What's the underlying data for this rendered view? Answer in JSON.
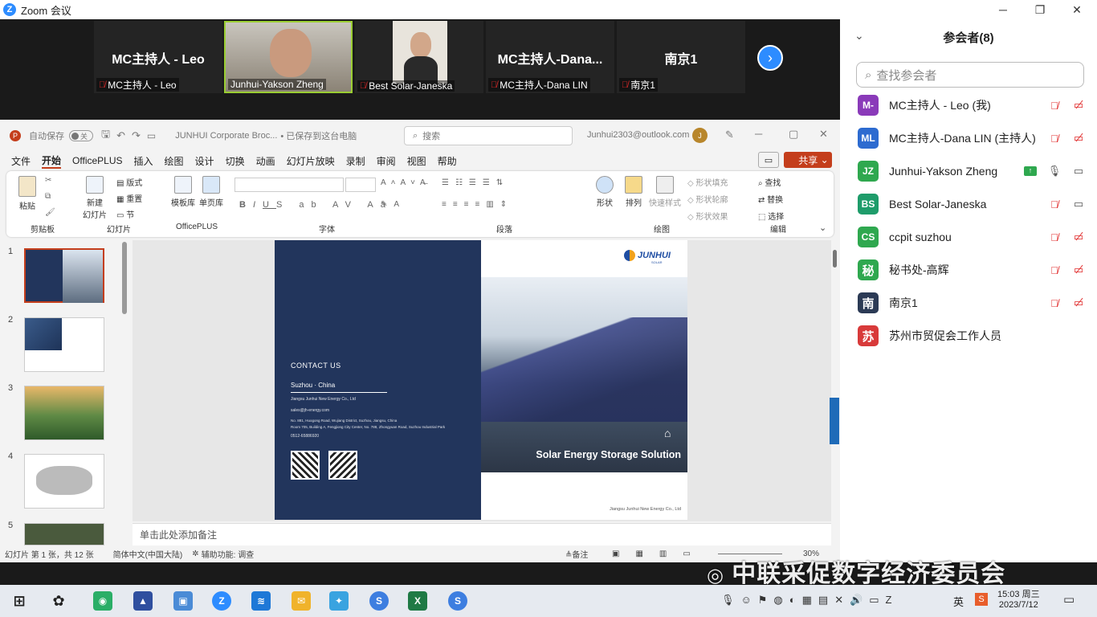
{
  "window": {
    "title": "Zoom 会议"
  },
  "colors": {
    "zoom_blue": "#2d8cff",
    "ppt_orange": "#c43e1c",
    "slide_navy": "#22355c"
  },
  "videos": [
    {
      "big": "MC主持人 - Leo",
      "label": "MC主持人 - Leo"
    },
    {
      "big": "",
      "label": "Junhui-Yakson Zheng"
    },
    {
      "big": "",
      "label": "Best Solar-Janeska"
    },
    {
      "big": "MC主持人-Dana...",
      "label": "MC主持人-Dana LIN"
    },
    {
      "big": "南京1",
      "label": "南京1"
    }
  ],
  "participants": {
    "title": "参会者(8)",
    "search_placeholder": "查找参会者",
    "list": [
      {
        "initials": "M-",
        "name": "MC主持人 - Leo (我)",
        "color": "#8a3ab9"
      },
      {
        "initials": "ML",
        "name": "MC主持人-Dana LIN (主持人)",
        "color": "#2d6bd0"
      },
      {
        "initials": "JZ",
        "name": "Junhui-Yakson Zheng",
        "color": "#2fa84f"
      },
      {
        "initials": "BS",
        "name": "Best Solar-Janeska",
        "color": "#1e9c6a"
      },
      {
        "initials": "CS",
        "name": "ccpit suzhou",
        "color": "#2fa84f"
      },
      {
        "initials": "秘",
        "name": "秘书处-高辉",
        "color": "#2fa84f"
      },
      {
        "initials": "南",
        "name": "南京1",
        "color": "#2b3a55"
      },
      {
        "initials": "苏",
        "name": "苏州市贸促会工作人员",
        "color": "#d83a3a"
      }
    ]
  },
  "ppt": {
    "autosave": "自动保存",
    "autosave_state": "关",
    "doc_title": "JUNHUI Corporate Broc...",
    "saved": "• 已保存到这台电脑",
    "search": "搜索",
    "account": "Junhui2303@outlook.com",
    "avatar": "J",
    "share": "共享",
    "menu": [
      "文件",
      "开始",
      "OfficePLUS",
      "插入",
      "绘图",
      "设计",
      "切换",
      "动画",
      "幻灯片放映",
      "录制",
      "审阅",
      "视图",
      "帮助"
    ],
    "groups": {
      "clipboard": "剪贴板",
      "slides": "幻灯片",
      "officeplus": "OfficePLUS",
      "font": "字体",
      "paragraph": "段落",
      "drawing": "绘图",
      "editing": "编辑"
    },
    "buttons": {
      "paste": "粘贴",
      "new_slide": "新建\n幻灯片",
      "layout": "版式",
      "reset": "重置",
      "section": "节",
      "template": "模板库",
      "onepage": "单页库",
      "shape": "形状",
      "arrange": "排列",
      "quick_style": "快速样式",
      "fill": "形状填充",
      "outline": "形状轮廓",
      "effect": "形状效果",
      "find": "查找",
      "replace": "替换",
      "select": "选择"
    },
    "notes_placeholder": "单击此处添加备注",
    "status": {
      "slide": "幻灯片 第 1 张，共 12 张",
      "lang": "简体中文(中国大陆)",
      "access": "辅助功能: 调查",
      "notes": "备注",
      "zoom": "30%"
    },
    "slide": {
      "contact": "CONTACT US",
      "city": "Suzhou · China",
      "company": "Jiangsu Junhui New Energy Co., Ltd",
      "email": "sales@jh-energy.com",
      "addr1": "No. 881, Huogong Road, Wujiang District, Suzhou, Jiangsu, China",
      "addr2": "Room 705, Building A, Fengjiong City Center, No. 788, Zhongyuan Road, Suzhou Industrial Park",
      "phone": "0512-65886920",
      "logo": "JUNHUI",
      "logo_sub": "SOLAR",
      "headline": "Solar Energy Storage Solution",
      "footer": "Jiangsu Junhui New Energy Co., Ltd"
    }
  },
  "watermark": "中联采促数字经济委员会",
  "tray": {
    "ime": "英",
    "time": "15:03 周三",
    "date": "2023/7/12"
  }
}
